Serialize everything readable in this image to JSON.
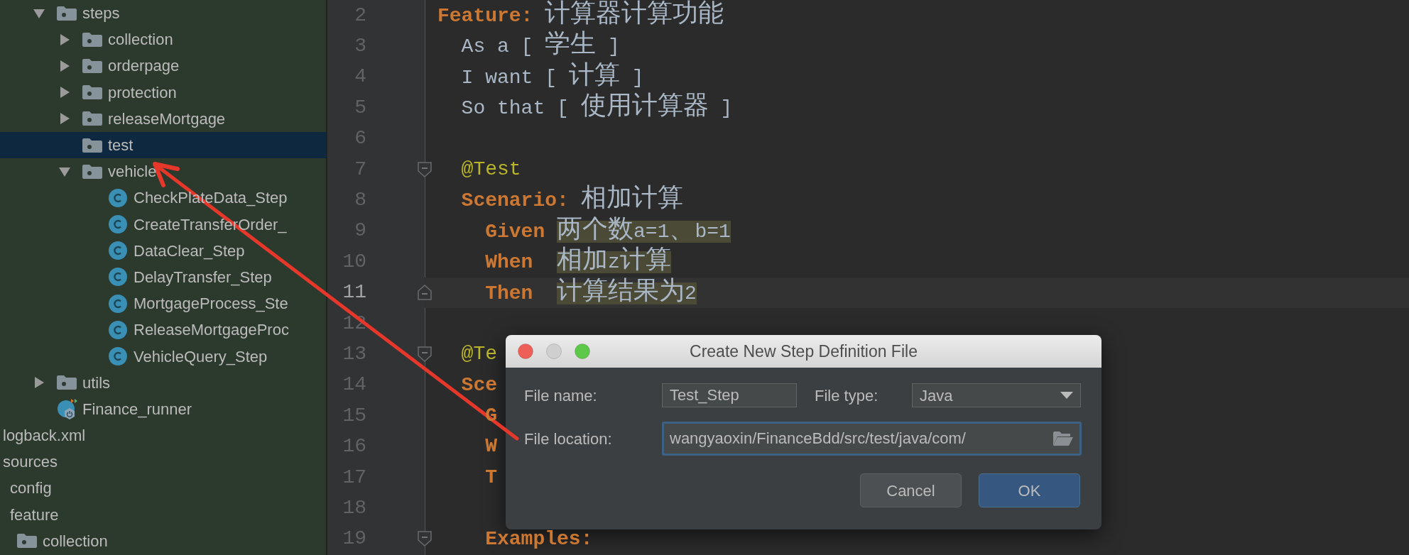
{
  "tree": {
    "inner": [
      {
        "label": "steps",
        "kind": "folder",
        "expanded": true,
        "selected": false,
        "children": [
          {
            "label": "collection",
            "kind": "folder",
            "expanded": false,
            "selected": false
          },
          {
            "label": "orderpage",
            "kind": "folder",
            "expanded": false,
            "selected": false
          },
          {
            "label": "protection",
            "kind": "folder",
            "expanded": false,
            "selected": false
          },
          {
            "label": "releaseMortgage",
            "kind": "folder",
            "expanded": false,
            "selected": false
          },
          {
            "label": "test",
            "kind": "folder",
            "selected": true
          },
          {
            "label": "vehicle",
            "kind": "folder",
            "expanded": true,
            "selected": false,
            "children": [
              {
                "label": "CheckPlateData_Step",
                "kind": "class",
                "selected": false
              },
              {
                "label": "CreateTransferOrder_",
                "kind": "class",
                "selected": false
              },
              {
                "label": "DataClear_Step",
                "kind": "class",
                "selected": false
              },
              {
                "label": "DelayTransfer_Step",
                "kind": "class",
                "selected": false
              },
              {
                "label": "MortgageProcess_Ste",
                "kind": "class",
                "selected": false
              },
              {
                "label": "ReleaseMortgageProc",
                "kind": "class",
                "selected": false
              },
              {
                "label": "VehicleQuery_Step",
                "kind": "class",
                "selected": false
              }
            ]
          }
        ]
      },
      {
        "label": "utils",
        "kind": "folder",
        "expanded": false,
        "selected": false
      },
      {
        "label": "Finance_runner",
        "kind": "runner",
        "selected": false
      }
    ],
    "outer": [
      {
        "label": "logback.xml",
        "selected": false
      },
      {
        "label": "sources",
        "selected": false,
        "children": [
          {
            "label": "config",
            "selected": false
          },
          {
            "label": "feature",
            "selected": false,
            "children": [
              {
                "label": "collection",
                "kind": "folder",
                "selected": false
              }
            ]
          }
        ]
      }
    ]
  },
  "editor": {
    "lines": [
      {
        "number": "2",
        "current": false,
        "segments": [
          {
            "kind": "keyword",
            "text": "Feature:"
          },
          {
            "kind": "text",
            "text": " 计算器计算功能"
          }
        ]
      },
      {
        "number": "3",
        "current": false,
        "segments": [
          {
            "kind": "text",
            "text": "  As a [ 学生 ]"
          }
        ]
      },
      {
        "number": "4",
        "current": false,
        "segments": [
          {
            "kind": "text",
            "text": "  I want [ 计算 ]"
          }
        ]
      },
      {
        "number": "5",
        "current": false,
        "segments": [
          {
            "kind": "text",
            "text": "  So that [ 使用计算器 ]"
          }
        ]
      },
      {
        "number": "6",
        "current": false
      },
      {
        "number": "7",
        "current": false,
        "fold_start": true,
        "segments": [
          {
            "kind": "tag",
            "text": "  @Test"
          }
        ]
      },
      {
        "number": "8",
        "current": false,
        "segments": [
          {
            "kind": "keyword",
            "text": "  Scenario:"
          },
          {
            "kind": "text",
            "text": " 相加计算"
          }
        ]
      },
      {
        "number": "9",
        "current": false,
        "segments": [
          {
            "kind": "keyword",
            "text": "    Given "
          },
          {
            "kind": "argument",
            "text": "两个数a=1、b=1"
          }
        ]
      },
      {
        "number": "10",
        "current": false,
        "segments": [
          {
            "kind": "keyword",
            "text": "    When  "
          },
          {
            "kind": "argument",
            "text": "相加z计算"
          }
        ]
      },
      {
        "number": "11",
        "current": true,
        "fold_end": true,
        "segments": [
          {
            "kind": "keyword",
            "text": "    Then  "
          },
          {
            "kind": "argument",
            "text": "计算结果为2"
          }
        ]
      },
      {
        "number": "12",
        "current": false
      },
      {
        "number": "13",
        "current": false,
        "fold_start": true,
        "segments": [
          {
            "kind": "tag",
            "text": "  @Te"
          }
        ]
      },
      {
        "number": "14",
        "current": false,
        "segments": [
          {
            "kind": "keyword",
            "text": "  Sce"
          }
        ]
      },
      {
        "number": "15",
        "current": false,
        "segments": [
          {
            "kind": "keyword",
            "text": "    G"
          }
        ]
      },
      {
        "number": "16",
        "current": false,
        "segments": [
          {
            "kind": "keyword",
            "text": "    W"
          }
        ]
      },
      {
        "number": "17",
        "current": false,
        "segments": [
          {
            "kind": "keyword",
            "text": "    T"
          }
        ]
      },
      {
        "number": "18",
        "current": false
      },
      {
        "number": "19",
        "current": false,
        "fold_start": true,
        "segments": [
          {
            "kind": "keyword",
            "text": "    Examples:"
          }
        ]
      }
    ]
  },
  "dialog": {
    "title": "Create New Step Definition File",
    "window_buttons": [
      {
        "kind": "close",
        "disabled": false
      },
      {
        "kind": "minimize",
        "disabled": true
      },
      {
        "kind": "zoom",
        "disabled": false
      }
    ],
    "file_name_label": "File name:",
    "file_name": "Test_Step",
    "file_type_label": "File type:",
    "file_type": "Java",
    "file_location_label": "File location:",
    "file_location": "wangyaoxin/FinanceBdd/src/test/java/com/",
    "buttons": [
      {
        "label": "Cancel",
        "kind": "secondary"
      },
      {
        "label": "OK",
        "kind": "primary"
      }
    ]
  }
}
